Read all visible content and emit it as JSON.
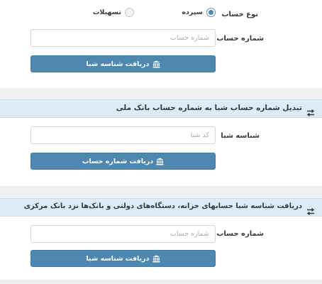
{
  "section1": {
    "account_type_label": "نوع حساب",
    "option_deposit": "سپرده",
    "option_facilities": "تسهیلات",
    "account_number_label": "شماره حساب",
    "account_number_placeholder": "شماره حساب",
    "button_label": "دریافت شناسه شبا"
  },
  "section2": {
    "title": "تبدیل شماره حساب شبا به شماره حساب بانک ملی",
    "sheba_label": "شناسه شبا",
    "sheba_placeholder": "کد شبا",
    "button_label": "دریافت شماره حساب"
  },
  "section3": {
    "title": "دریافت شناسه شبا حسابهای خزانه، دستگاه‌های دولتی و بانک‌ها نزد بانک مرکزی",
    "account_number_label": "شماره حساب",
    "account_number_placeholder": "شماره حساب",
    "button_label": "دریافت شناسه شبا"
  },
  "colors": {
    "button": "#4e88b1",
    "section_header": "#dcecf6",
    "separator": "#eef0f2"
  },
  "icons": {
    "button_icon": "bank-icon",
    "section_icon": "swap-arrows-icon"
  }
}
